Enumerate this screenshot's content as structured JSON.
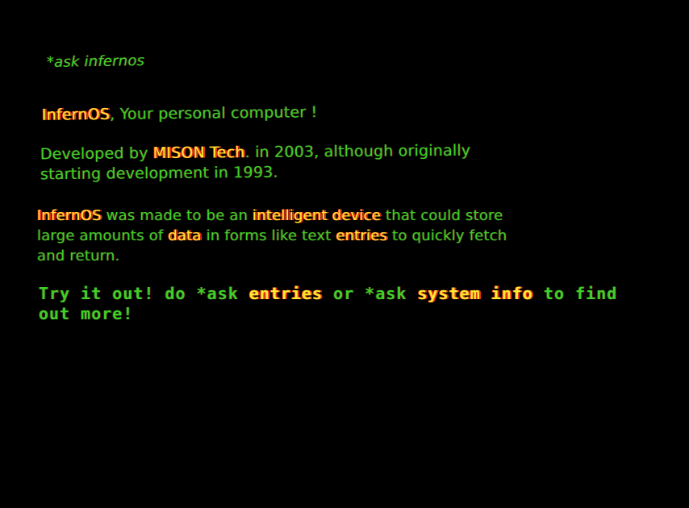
{
  "terminal": {
    "command": "*ask infernos",
    "para1": {
      "name": "InfernOS",
      "rest": ",  Your personal computer !"
    },
    "para2": {
      "pre": "Developed by ",
      "company": "MISON Tech",
      "post1": ".  in 2003,  although originally",
      "line2": "starting development in 1993."
    },
    "para3": {
      "name": "InfernOS",
      "t1": " was made to be an ",
      "h1": "intelligent device",
      "t2": " that could store",
      "t3": "large amounts of ",
      "h2": "data",
      "t4": " in forms like text ",
      "h3": "entries",
      "t5": " to quickly fetch",
      "line3": "and return."
    },
    "para4": {
      "t1": "Try it out! do *ask ",
      "h1": "entries",
      "t2": " or *ask ",
      "h2": "system info",
      "t3": " to find",
      "line2": "out more!"
    }
  },
  "colors": {
    "background": "#000000",
    "text": "#3fcf2a",
    "highlight": "#ffea2e",
    "fringe": "#e0301a"
  }
}
